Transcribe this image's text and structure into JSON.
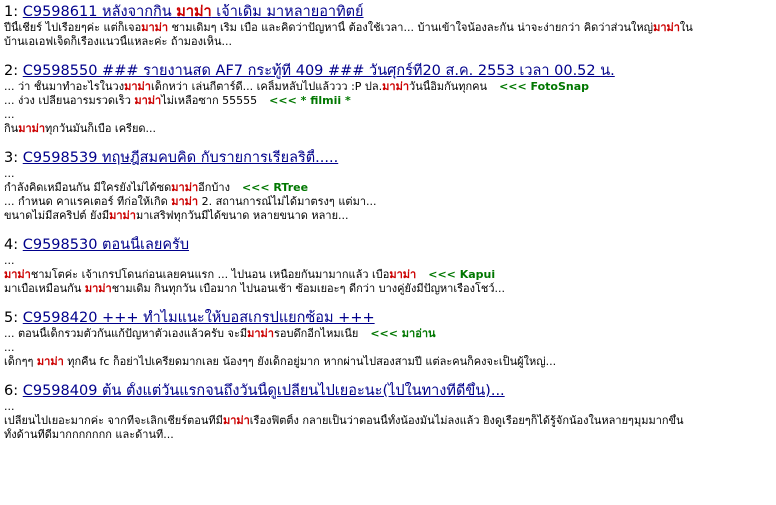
{
  "results": [
    {
      "num": "1:",
      "title": [
        {
          "t": "C9598611 หลังจากกิน "
        },
        {
          "t": "มาม่า",
          "h": true
        },
        {
          "t": " เจ้าเดิม มาหลายอาทิตย์"
        }
      ],
      "lines": [
        {
          "segs": [
            {
              "t": "ปีนี้เชียร์ "
            },
            {
              "t": "ไปเรื่อยๆค่ะ แต่ก็เจอ"
            },
            {
              "t": "มาม่า",
              "h": true
            },
            {
              "t": " ชามเดิมๆ เริ่ม เบื่อ และคิดว่าปัญหานี้ ต้องใช้เวลา... บ้านเข้าใจน้องละกัน น่าจะง่ายกว่า คิดว่าส่วนใหญ่"
            },
            {
              "t": "มาม่า",
              "h": true
            },
            {
              "t": "ใน"
            }
          ]
        },
        {
          "segs": [
            {
              "t": "บ้านเอเอฟเจ็ดก็เรื่องแนวนี้แหละค่ะ ถ้ามองเห็น..."
            }
          ]
        }
      ]
    },
    {
      "num": "2:",
      "title": [
        {
          "t": "C9598550 ### รายงานสด AF7 กระทู้ที่ 409 ### วันศุกร์ที่20 ส.ค. 2553 เวลา 00.52 น."
        }
      ],
      "lines": [
        {
          "segs": [
            {
              "t": "... ว่า ชั้นมาทำอะไรในวง"
            },
            {
              "t": "มาม่า",
              "h": true
            },
            {
              "t": "เด็กหว่า เล่นกีตาร์ดี... เคลิ้มหลับไปแล้ววว :P ปล."
            },
            {
              "t": "มาม่า",
              "h": true
            },
            {
              "t": "วันนี้อิ่มกันทุกคน"
            }
          ],
          "author": "<<< FotoSnap"
        },
        {
          "segs": [
            {
              "t": "... ง่วง เปลี่ยนอารมรวดเร็ว "
            },
            {
              "t": "มาม่า",
              "h": true
            },
            {
              "t": "ไม่เหลือซาก 55555"
            }
          ],
          "author": "<<< * filmii *"
        },
        {
          "segs": [
            {
              "t": "..."
            }
          ]
        },
        {
          "segs": [
            {
              "t": "กิน"
            },
            {
              "t": "มาม่า",
              "h": true
            },
            {
              "t": "ทุกวันมันก็เบื่อ เครียด..."
            }
          ]
        }
      ]
    },
    {
      "num": "3:",
      "title": [
        {
          "t": "C9598539 ทฤษฎีสมคบคิด กับรายการเรียลริตี้....."
        }
      ],
      "lines": [
        {
          "segs": [
            {
              "t": "..."
            }
          ]
        },
        {
          "segs": [
            {
              "t": "กำลังคิดเหมือนกัน มีใครยังไม่ได้ซด"
            },
            {
              "t": "มาม่า",
              "h": true
            },
            {
              "t": "อีกบ้าง"
            }
          ],
          "author": "<<< RTree"
        },
        {
          "segs": [
            {
              "t": "... กำหนด คาแรคเตอร์ ที่ก่อให้เกิด "
            },
            {
              "t": "มาม่า",
              "h": true
            },
            {
              "t": " 2. สถานการณ์ไม่ได้มาตรงๆ แต่มา..."
            }
          ]
        },
        {
          "segs": [
            {
              "t": "ขนาดไม่มีสคริปต์ ยังมี"
            },
            {
              "t": "มาม่า",
              "h": true
            },
            {
              "t": "มาเสริฟทุกวันมีได้ขนาด หลายขนาด หลาย..."
            }
          ]
        }
      ]
    },
    {
      "num": "4:",
      "title": [
        {
          "t": "C9598530 ตอนนี้เลยครับ"
        }
      ],
      "lines": [
        {
          "segs": [
            {
              "t": "..."
            }
          ]
        },
        {
          "segs": [
            {
              "t": "มาม่า",
              "h": true
            },
            {
              "t": "ชามโตค่ะ เจ้าเกรปโดนก่อนเลยคนแรก ... ไปนอน เหนื่อยกันมามากแล้ว เบื่อ"
            },
            {
              "t": "มาม่า",
              "h": true
            }
          ],
          "author": "<<< Kapui"
        },
        {
          "segs": [
            {
              "t": "มาเบื่อเหมือนกัน "
            },
            {
              "t": "มาม่า",
              "h": true
            },
            {
              "t": "ชามเดิม กินทุกวัน เบื่อมาก ไปนอนเช้า ซ้อมเยอะๆ ดีกว่า บางคู่ยังมีปัญหาเรื่องโชว์..."
            }
          ]
        }
      ]
    },
    {
      "num": "5:",
      "title": [
        {
          "t": "C9598420 +++ ทำไมแนะให้บอสเกรปแยกซ้อม +++"
        }
      ],
      "lines": [
        {
          "segs": [
            {
              "t": "... ตอนนี้เด็กรวมตัวกันแก้ปัญหาตัวเองแล้วครับ จะมี"
            },
            {
              "t": "มาม่า",
              "h": true
            },
            {
              "t": "รอบดึกอีกไหมเนี่ย"
            }
          ],
          "author": "<<< มาอ่าน"
        },
        {
          "segs": [
            {
              "t": "..."
            }
          ]
        },
        {
          "segs": [
            {
              "t": "เด็กๆๆ "
            },
            {
              "t": "มาม่า",
              "h": true
            },
            {
              "t": " ทุกคืน fc ก็อย่าไปเครียดมากเลย น้องๆๆ ยังเด็กอยู่มาก หากผ่านไปสองสามปี แต่ละคนก็คงจะเป็นผู้ใหญ่..."
            }
          ]
        }
      ]
    },
    {
      "num": "6:",
      "title": [
        {
          "t": "C9598409 ต้น ตั้งแต่วันแรกจนถึงวันนี้ดูเปลี่ยนไปเยอะนะ(ไปในทางที่ดีขึ้น)..."
        }
      ],
      "lines": [
        {
          "segs": [
            {
              "t": "..."
            }
          ]
        },
        {
          "segs": [
            {
              "t": "เปลี่ยนไปเยอะมากค่ะ จากที่จะเลิกเชียร์ตอนที่มี"
            },
            {
              "t": "มาม่า",
              "h": true
            },
            {
              "t": "เรื่องฟิตติ้ง กลายเป็นว่าตอนนี้ทั้งน้องมันไม่ลงแล้ว ยิ่งดูเรื่อยๆก็ได้รู้จักน้องในหลายๆมุมมากขึ้น"
            }
          ]
        },
        {
          "segs": [
            {
              "t": "ทั้งด้านที่ดีมากกกกกกก และด้านที่..."
            }
          ]
        }
      ]
    }
  ]
}
